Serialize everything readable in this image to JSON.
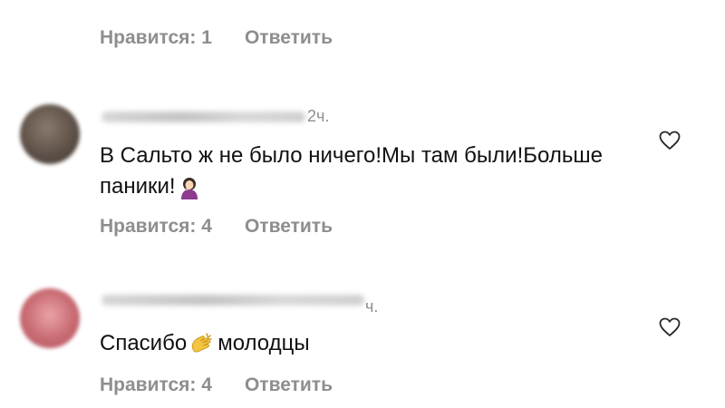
{
  "top_comment": {
    "likes_label": "Нравится: 1",
    "reply_label": "Ответить"
  },
  "comments": [
    {
      "time": "2ч.",
      "text": "В Сальто ж не было ничего!Мы там были!Больше паники!",
      "emoji": "woman-facepalming-icon",
      "likes_label": "Нравится: 4",
      "reply_label": "Ответить"
    },
    {
      "time": "ч.",
      "text_before": "Спасибо",
      "text_after": "молодцы",
      "emoji": "clapping-hands-icon",
      "likes_label": "Нравится: 4",
      "reply_label": "Ответить"
    }
  ],
  "colors": {
    "secondary_text": "#8e8e8e",
    "primary_text": "#111111",
    "background": "#ffffff"
  }
}
